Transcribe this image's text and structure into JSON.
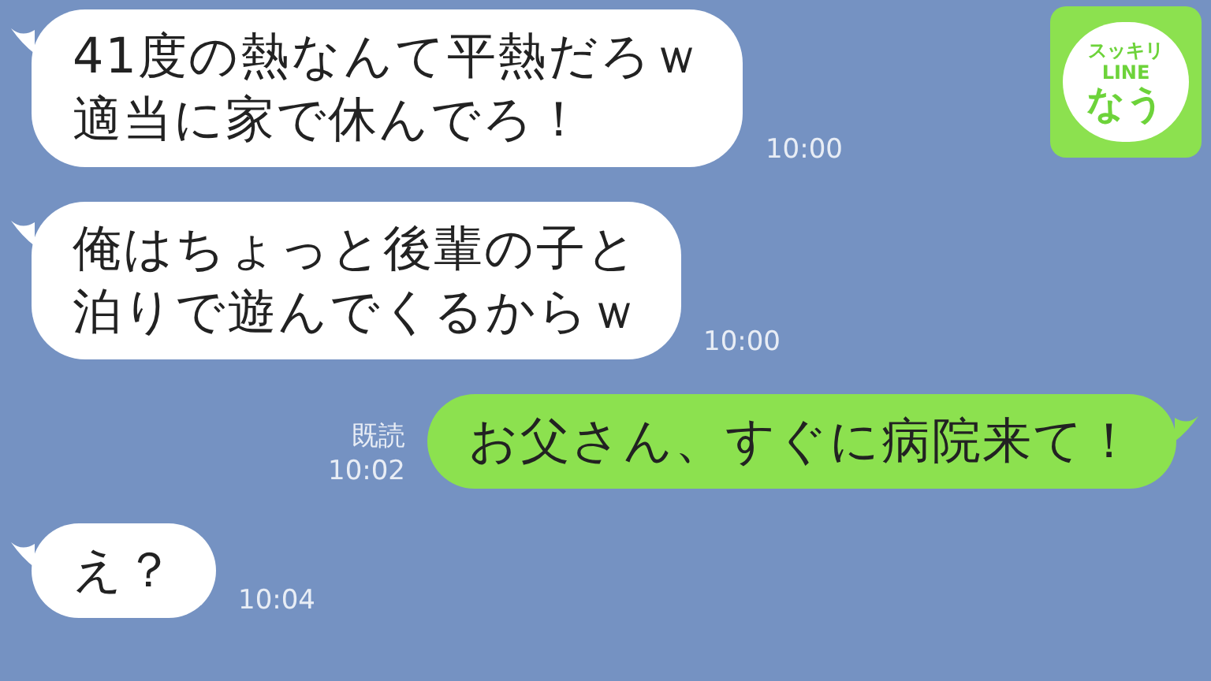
{
  "messages": [
    {
      "kind": "received",
      "lines": [
        "41度の熱なんて平熱だろｗ",
        "適当に家で休んでろ！"
      ],
      "time": "10:00"
    },
    {
      "kind": "received",
      "lines": [
        "俺はちょっと後輩の子と",
        "泊りで遊んでくるからｗ"
      ],
      "time": "10:00"
    },
    {
      "kind": "sent",
      "lines": [
        "お父さん、すぐに病院来て！"
      ],
      "read": "既読",
      "time": "10:02"
    },
    {
      "kind": "received",
      "lines": [
        "え？"
      ],
      "time": "10:04"
    }
  ],
  "logo": {
    "top": "スッキリ",
    "middle": "LINE",
    "bottom": "なう"
  }
}
